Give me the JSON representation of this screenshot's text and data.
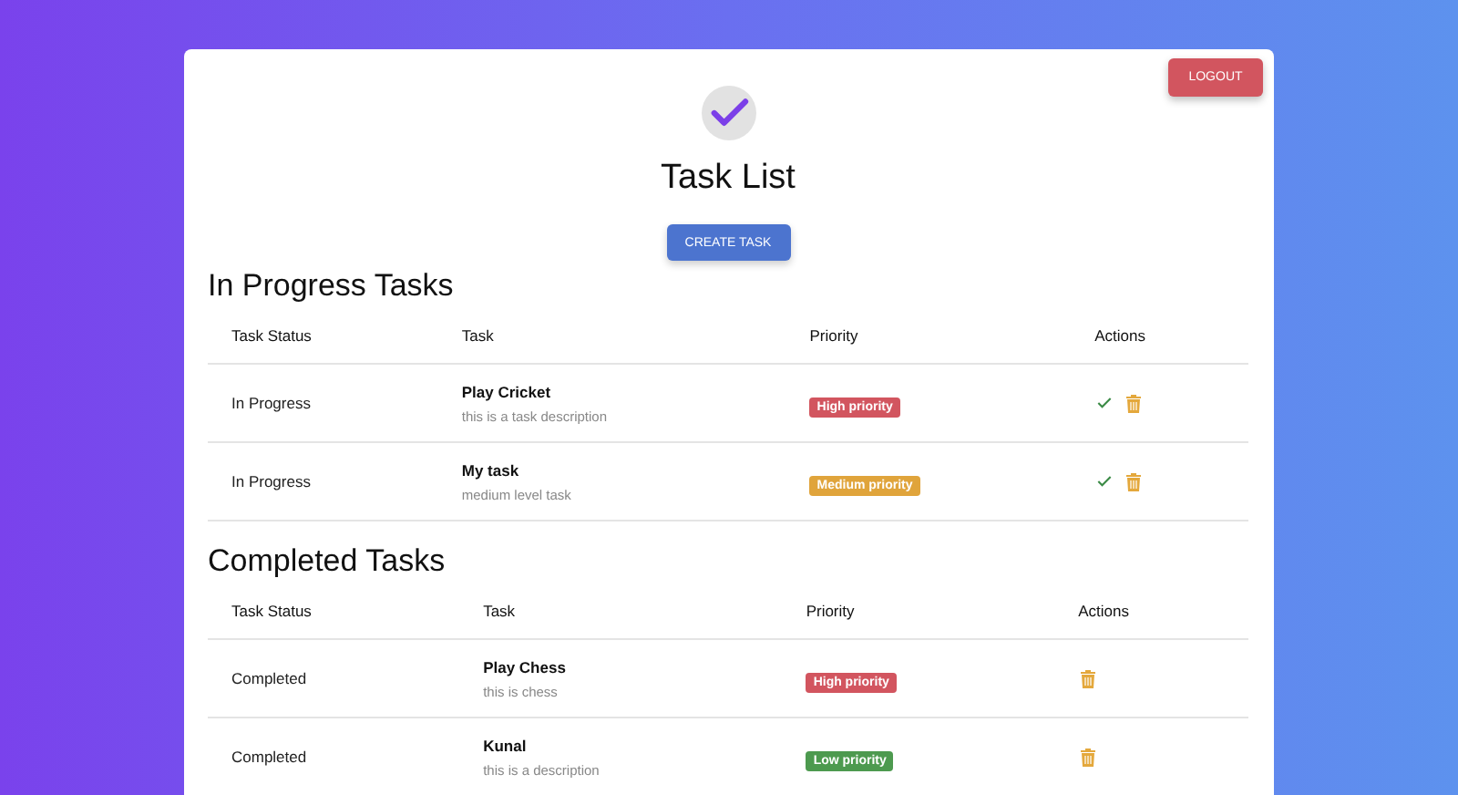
{
  "logout_button": "LOGOUT",
  "title": "Task List",
  "create_button": "CREATE TASK",
  "sections": [
    {
      "heading": "In Progress Tasks",
      "columns": [
        "Task Status",
        "Task",
        "Priority",
        "Actions"
      ],
      "rows": [
        {
          "status": "In Progress",
          "task": "Play Cricket",
          "description": "this is a task description",
          "priority": {
            "label": "High priority",
            "kind": "high"
          },
          "actions": [
            {
              "kind": "complete"
            },
            {
              "kind": "delete"
            }
          ]
        },
        {
          "status": "In Progress",
          "task": "My task",
          "description": "medium level task",
          "priority": {
            "label": "Medium priority",
            "kind": "medium"
          },
          "actions": [
            {
              "kind": "complete"
            },
            {
              "kind": "delete"
            }
          ]
        }
      ]
    },
    {
      "heading": "Completed Tasks",
      "columns": [
        "Task Status",
        "Task",
        "Priority",
        "Actions"
      ],
      "rows": [
        {
          "status": "Completed",
          "task": "Play Chess",
          "description": "this is chess",
          "priority": {
            "label": "High priority",
            "kind": "high"
          },
          "actions": [
            {
              "kind": "delete"
            }
          ]
        },
        {
          "status": "Completed",
          "task": "Kunal",
          "description": "this is a description",
          "priority": {
            "label": "Low priority",
            "kind": "low"
          },
          "actions": [
            {
              "kind": "delete"
            }
          ]
        }
      ]
    }
  ]
}
